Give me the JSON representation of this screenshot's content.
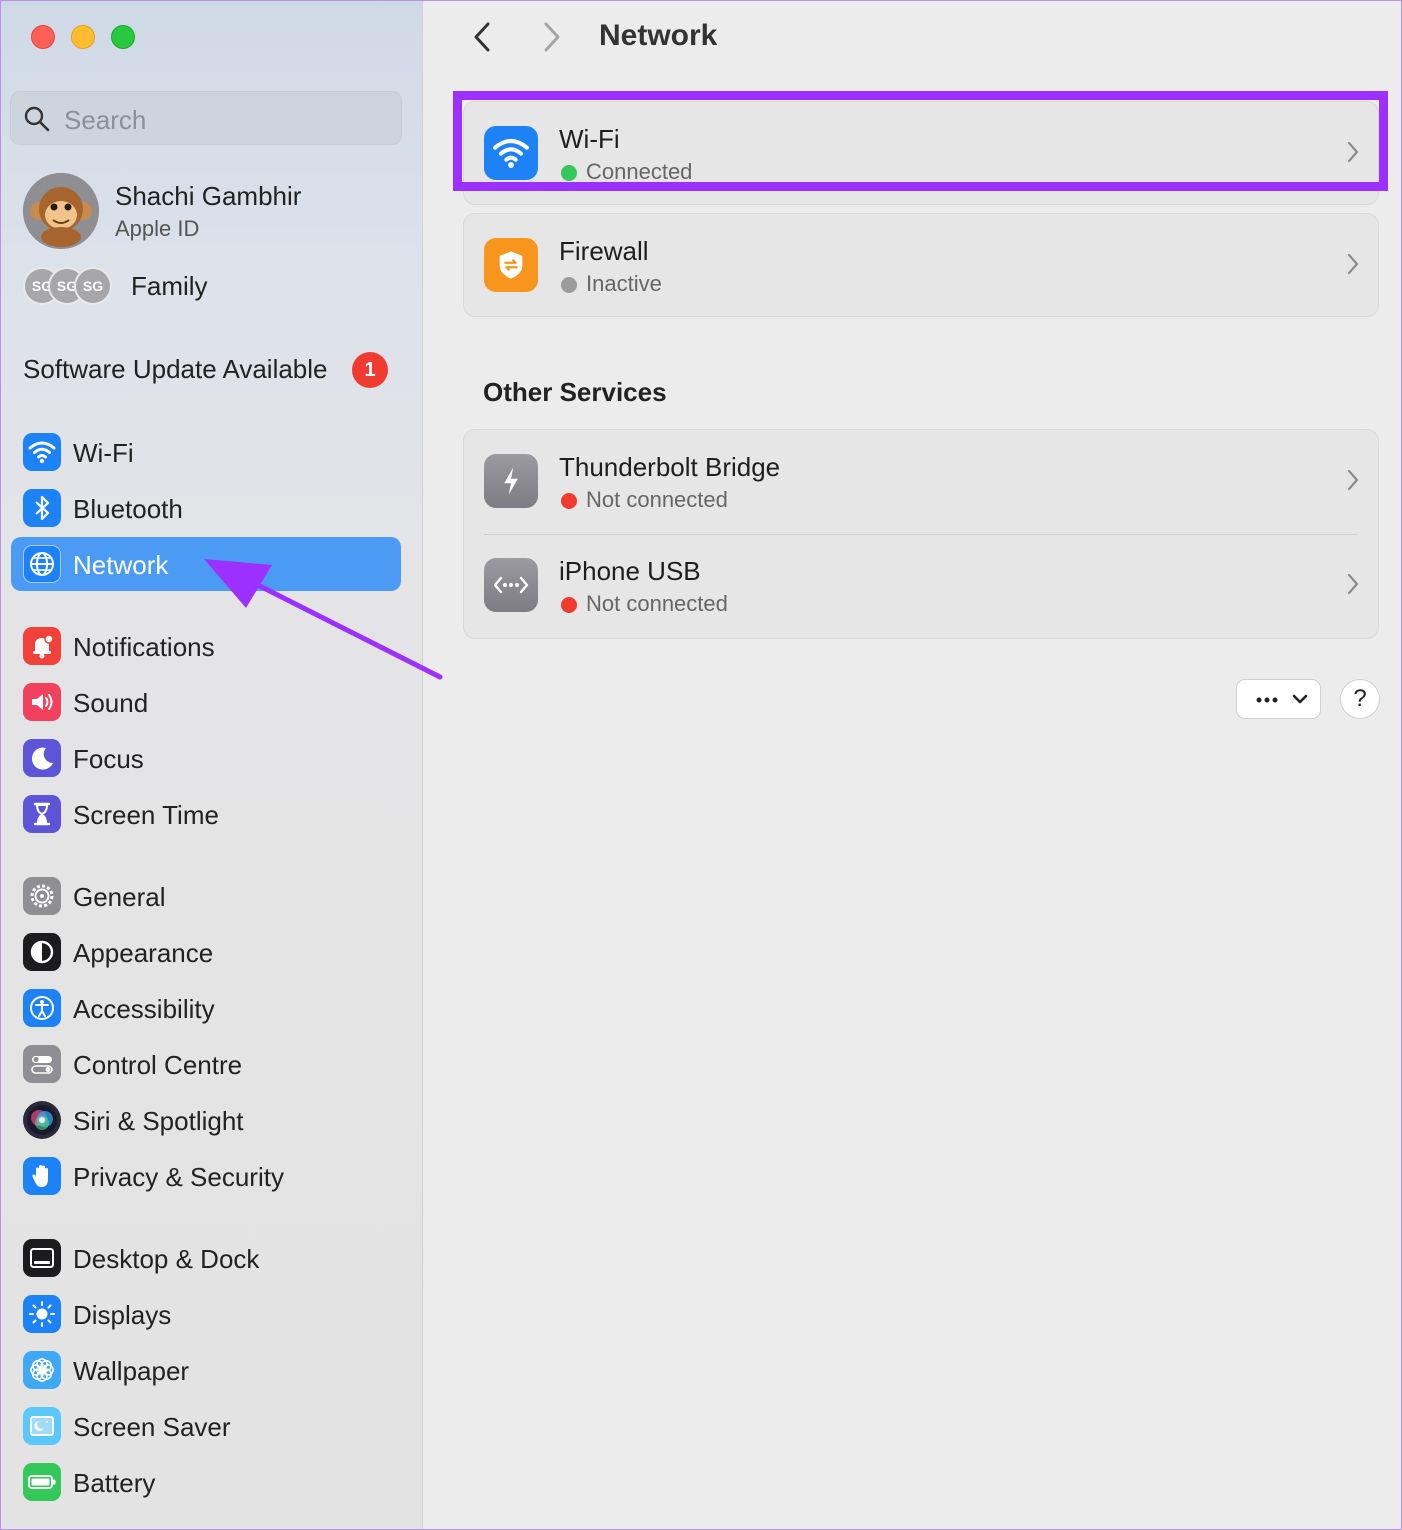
{
  "window": {
    "title": "Network",
    "controls": [
      "close",
      "minimize",
      "zoom"
    ]
  },
  "sidebar": {
    "search": {
      "placeholder": "Search",
      "icon": "search-icon"
    },
    "profile": {
      "name": "Shachi Gambhir",
      "subtitle": "Apple ID"
    },
    "family": {
      "label": "Family",
      "avatars": [
        "SG",
        "SG",
        "SG"
      ]
    },
    "update": {
      "label": "Software Update Available",
      "badge": "1"
    },
    "items": [
      {
        "label": "Wi-Fi",
        "icon": "wifi-icon",
        "color": "#1e82f7"
      },
      {
        "label": "Bluetooth",
        "icon": "bluetooth-icon",
        "color": "#1e82f7"
      },
      {
        "label": "Network",
        "icon": "globe-icon",
        "color": "#1e82f7",
        "selected": true
      },
      {
        "label": "Notifications",
        "icon": "bell-icon",
        "color": "#f0413a"
      },
      {
        "label": "Sound",
        "icon": "speaker-icon",
        "color": "#f0415e"
      },
      {
        "label": "Focus",
        "icon": "moon-icon",
        "color": "#5d55d8"
      },
      {
        "label": "Screen Time",
        "icon": "hourglass-icon",
        "color": "#5d55d8"
      },
      {
        "label": "General",
        "icon": "gear-icon",
        "color": "#8e8e93"
      },
      {
        "label": "Appearance",
        "icon": "appearance-icon",
        "color": "#1c1c1e"
      },
      {
        "label": "Accessibility",
        "icon": "accessibility-icon",
        "color": "#1e82f7"
      },
      {
        "label": "Control Centre",
        "icon": "toggles-icon",
        "color": "#8e8e93"
      },
      {
        "label": "Siri & Spotlight",
        "icon": "siri-icon",
        "color": "#2a2a3a"
      },
      {
        "label": "Privacy & Security",
        "icon": "hand-icon",
        "color": "#1e82f7"
      },
      {
        "label": "Desktop & Dock",
        "icon": "dock-icon",
        "color": "#1c1c1e"
      },
      {
        "label": "Displays",
        "icon": "sun-icon",
        "color": "#1e82f7"
      },
      {
        "label": "Wallpaper",
        "icon": "flower-icon",
        "color": "#3fa9f5"
      },
      {
        "label": "Screen Saver",
        "icon": "screensaver-icon",
        "color": "#5ac8fa"
      },
      {
        "label": "Battery",
        "icon": "battery-icon",
        "color": "#34c759"
      }
    ]
  },
  "main": {
    "title": "Network",
    "primary": [
      {
        "title": "Wi-Fi",
        "status": "Connected",
        "status_color": "#34c759",
        "icon": "wifi-icon",
        "icon_color": "#1e82f7"
      },
      {
        "title": "Firewall",
        "status": "Inactive",
        "status_color": "#9b9b9b",
        "icon": "shield-icon",
        "icon_color": "#f8951d"
      }
    ],
    "section_title": "Other Services",
    "services": [
      {
        "title": "Thunderbolt Bridge",
        "status": "Not connected",
        "status_color": "#f23a2f",
        "icon": "thunderbolt-icon"
      },
      {
        "title": "iPhone USB",
        "status": "Not connected",
        "status_color": "#f23a2f",
        "icon": "usb-dots-icon"
      }
    ],
    "more_button": "more-options-icon",
    "help_button": "?"
  },
  "annotation": {
    "highlight_color": "#9b30ff"
  }
}
